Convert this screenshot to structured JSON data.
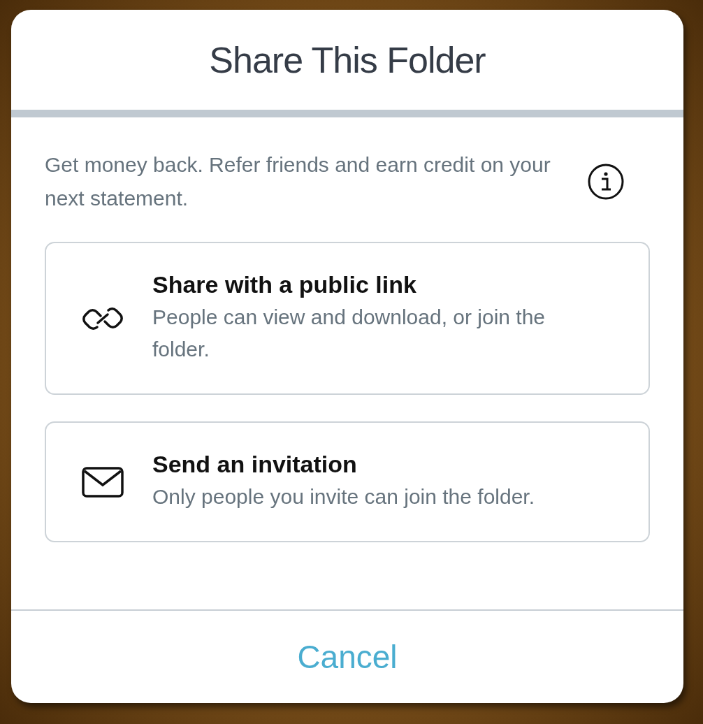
{
  "dialog": {
    "title": "Share This Folder",
    "description": "Get money back. Refer friends and earn credit on your next statement.",
    "options": [
      {
        "kind": "link",
        "title": "Share with a public link",
        "description": "People can view and download, or join the folder."
      },
      {
        "kind": "mail",
        "title": "Send an invitation",
        "description": "Only people you invite can join the folder."
      }
    ],
    "cancel": "Cancel"
  }
}
